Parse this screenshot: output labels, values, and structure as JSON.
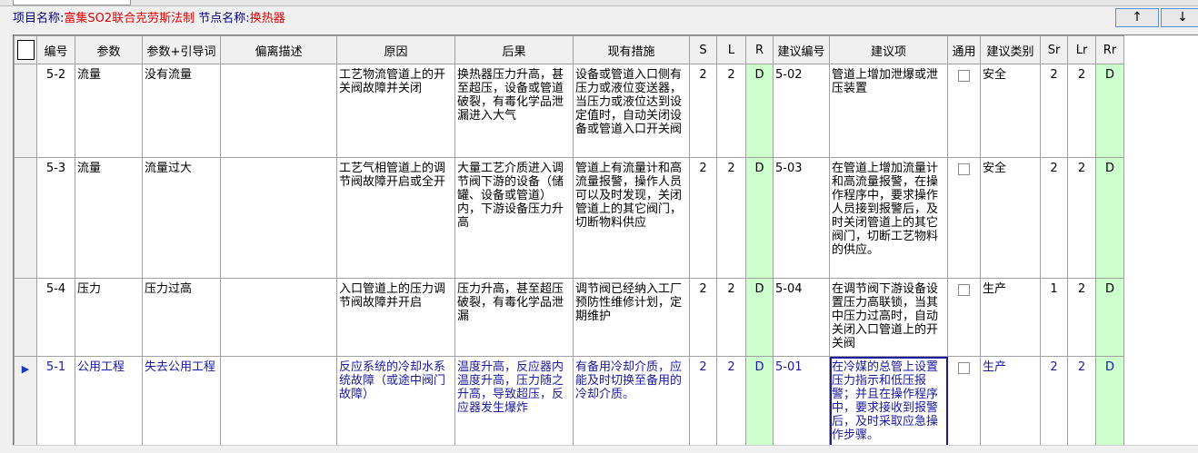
{
  "header": {
    "project_label": "项目名称:",
    "project_name": "富集SO2联合克劳斯法制",
    "node_label": "节点名称:",
    "node_name": "换热器"
  },
  "nav": {
    "up_label": "↑",
    "down_label": "↓"
  },
  "table": {
    "columns": [
      "编号",
      "参数",
      "参数+引导词",
      "偏离描述",
      "原因",
      "后果",
      "现有措施",
      "S",
      "L",
      "R",
      "建议编号",
      "建议项",
      "通用",
      "建议类别",
      "Sr",
      "Lr",
      "Rr"
    ],
    "rows": [
      {
        "id": "5-2",
        "param": "流量",
        "guide": "没有流量",
        "deviation": "",
        "cause": "工艺物流管道上的开关阀故障并关闭",
        "consequence": "换热器压力升高，甚至超压，设备或管道破裂，有毒化学品泄漏进入大气",
        "measures": "设备或管道入口侧有压力或液位变送器，当压力或液位达到设定值时，自动关闭设备或管道入口开关阀",
        "s": "2",
        "l": "2",
        "r": "D",
        "rec_id": "5-02",
        "rec": "管道上增加泄爆或泄压装置",
        "general": false,
        "category": "安全",
        "sr": "2",
        "lr": "2",
        "rr": "D"
      },
      {
        "id": "5-3",
        "param": "流量",
        "guide": "流量过大",
        "deviation": "",
        "cause": "工艺气相管道上的调节阀故障开启或全开",
        "consequence": "大量工艺介质进入调节阀下游的设备（储罐、设备或管道）内，下游设备压力升高",
        "measures": "管道上有流量计和高流量报警，操作人员可以及时发现，关闭管道上的其它阀门，切断物料供应",
        "s": "2",
        "l": "2",
        "r": "D",
        "rec_id": "5-03",
        "rec": "在管道上增加流量计和高流量报警，在操作程序中，要求操作人员接到报警后，及时关闭管道上的其它阀门，切断工艺物料的供应。",
        "general": false,
        "category": "安全",
        "sr": "2",
        "lr": "2",
        "rr": "D"
      },
      {
        "id": "5-4",
        "param": "压力",
        "guide": "压力过高",
        "deviation": "",
        "cause": "入口管道上的压力调节阀故障并开启",
        "consequence": "压力升高，甚至超压破裂，有毒化学品泄漏",
        "measures": "调节阀已经纳入工厂预防性维修计划，定期维护",
        "s": "2",
        "l": "2",
        "r": "D",
        "rec_id": "5-04",
        "rec": "在调节阀下游设备设置压力高联锁，当其中压力过高时，自动关闭入口管道上的开关阀",
        "general": false,
        "category": "生产",
        "sr": "1",
        "lr": "2",
        "rr": "D"
      },
      {
        "id": "5-1",
        "param": "公用工程",
        "guide": "失去公用工程",
        "deviation": "",
        "cause": "反应系统的冷却水系统故障（或途中阀门故障）",
        "consequence": "温度升高，反应器内温度升高，压力随之升高，导致超压，反应器发生爆炸",
        "measures": "有备用冷却介质，应能及时切换至备用的冷却介质。",
        "s": "2",
        "l": "2",
        "r": "D",
        "rec_id": "5-01",
        "rec": "在冷媒的总管上设置压力指示和低压报警；并且在操作程序中，要求接收到报警后，及时采取应急操作步骤。",
        "general": false,
        "category": "生产",
        "sr": "2",
        "lr": "2",
        "rr": "D"
      }
    ]
  }
}
